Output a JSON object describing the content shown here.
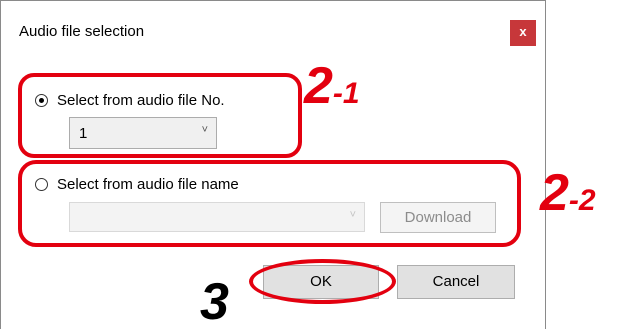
{
  "dialog": {
    "title": "Audio file selection",
    "close_label": "x",
    "option_number": {
      "label": "Select from audio file No.",
      "selected": true,
      "combo_value": "1",
      "chevron": "˅"
    },
    "option_name": {
      "label": "Select from audio file name",
      "selected": false,
      "combo_value": "",
      "chevron": "˅",
      "download_label": "Download"
    },
    "ok_label": "OK",
    "cancel_label": "Cancel"
  },
  "annotations": {
    "a21_main": "2",
    "a21_sub": "-1",
    "a22_main": "2",
    "a22_sub": "-2",
    "a3": "3"
  },
  "colors": {
    "highlight": "#e3000f",
    "close_button": "#c7373a"
  }
}
